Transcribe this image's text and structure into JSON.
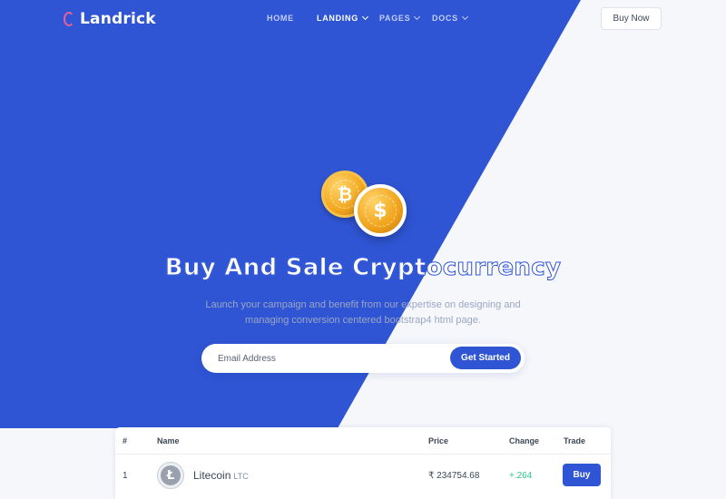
{
  "brand": {
    "name": "Landrick"
  },
  "nav": {
    "items": [
      {
        "label": "HOME",
        "active": false,
        "dropdown": false
      },
      {
        "label": "LANDING",
        "active": true,
        "dropdown": true
      },
      {
        "label": "PAGES",
        "active": false,
        "dropdown": true
      },
      {
        "label": "DOCS",
        "active": false,
        "dropdown": true
      }
    ],
    "cta_label": "Buy Now"
  },
  "hero": {
    "title": "Buy And Sale Cryptocurrency",
    "subtitle_line1": "Launch your campaign and benefit from our expertise on designing and",
    "subtitle_line2": "managing conversion centered bootstrap4 html page.",
    "coin_btc_symbol": "₿",
    "coin_usd_symbol": "$"
  },
  "signup": {
    "email_placeholder": "Email Address",
    "email_value": "",
    "submit_label": "Get Started"
  },
  "table": {
    "headers": [
      "#",
      "Name",
      "Price",
      "Change",
      "Trade"
    ],
    "rows": [
      {
        "index": "1",
        "logo_glyph": "Ł",
        "name": "Litecoin",
        "symbol": "LTC",
        "price": "₹ 234754.68",
        "change": "+.264",
        "trade_label": "Buy"
      }
    ]
  },
  "colors": {
    "primary": "#2f55d4",
    "background": "#f5f7fb",
    "positive": "#2eca8b",
    "text": "#3c4858",
    "logo_accent": "#e95f99",
    "coin_gold": "#f2a71d"
  }
}
